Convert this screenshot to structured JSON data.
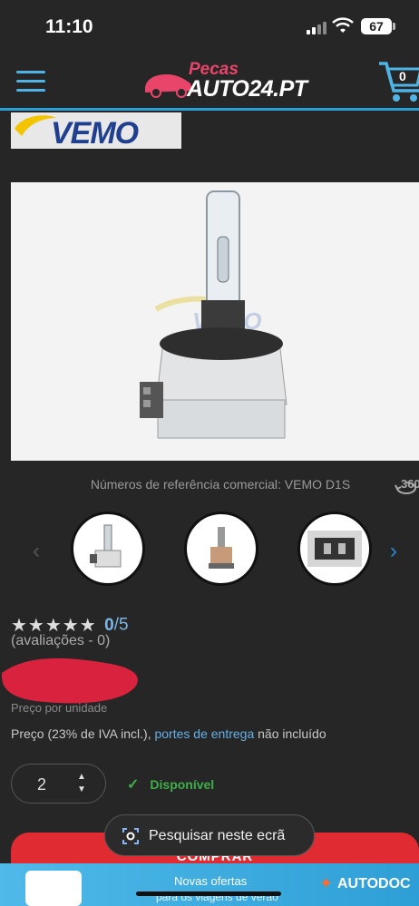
{
  "status_bar": {
    "time": "11:10",
    "battery": "67"
  },
  "header": {
    "logo_top": "Pecas",
    "logo_main": "AUTO24.PT",
    "cart_count": "0"
  },
  "brand": {
    "name": "VEMO"
  },
  "product": {
    "image_brand": "VEMO",
    "reference": "Números de referência comercial: VEMO D1S",
    "rotate_label": "360",
    "rating": {
      "stars_filled": 0,
      "stars_total": 5,
      "score": "0",
      "max": "/5",
      "reviews_label": "(avaliações - 0)"
    },
    "unit_label": "Preço por unidade",
    "price_note": {
      "prefix": "Preço (23% de IVA incl.), ",
      "link": "portes de entrega",
      "suffix": " não incluído"
    },
    "quantity": "2",
    "availability": "Disponível",
    "buy_label": "COMPRAR"
  },
  "overlay": {
    "search_label": "Pesquisar neste ecrã"
  },
  "ad": {
    "title": "Novas ofertas",
    "subtitle": "para os viagens de verão",
    "brand": "AUTODOC"
  },
  "colors": {
    "accent": "#2aa0d8",
    "buy": "#e02b33",
    "available": "#3fae49",
    "link": "#66b0e6"
  }
}
